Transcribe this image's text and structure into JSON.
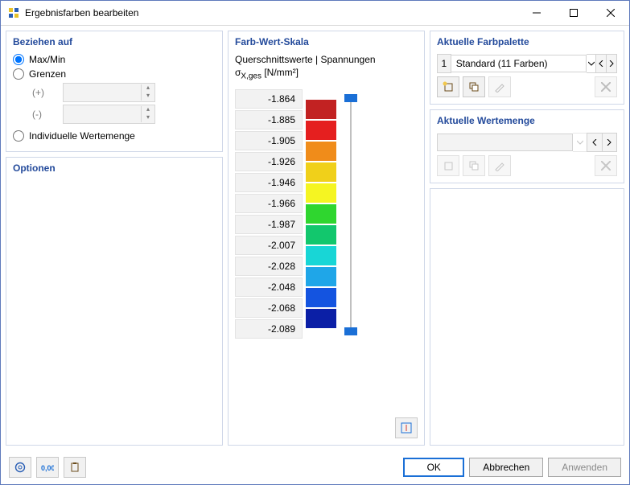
{
  "window": {
    "title": "Ergebnisfarben bearbeiten"
  },
  "left": {
    "refer_title": "Beziehen auf",
    "opt_maxmin": "Max/Min",
    "opt_bounds": "Grenzen",
    "plus": "(+)",
    "minus": "(-)",
    "opt_indiv": "Individuelle Wertemenge",
    "options_title": "Optionen"
  },
  "mid": {
    "title": "Farb-Wert-Skala",
    "sub1": "Querschnittswerte | Spannungen",
    "sub2": "σ",
    "sub2_idx": "X,ges",
    "sub2_unit": " [N/mm²]",
    "scale": [
      {
        "v": "-1.864",
        "c": "#c22222"
      },
      {
        "v": "-1.885",
        "c": "#e51f1f"
      },
      {
        "v": "-1.905",
        "c": "#f08c1a"
      },
      {
        "v": "-1.926",
        "c": "#f0d01a"
      },
      {
        "v": "-1.946",
        "c": "#f5f522"
      },
      {
        "v": "-1.966",
        "c": "#2fd62f"
      },
      {
        "v": "-1.987",
        "c": "#12c76d"
      },
      {
        "v": "-2.007",
        "c": "#18d6d6"
      },
      {
        "v": "-2.028",
        "c": "#1fa6e8"
      },
      {
        "v": "-2.048",
        "c": "#1454e0"
      },
      {
        "v": "-2.068",
        "c": "#0b1fa6"
      },
      {
        "v": "-2.089",
        "c": ""
      }
    ]
  },
  "right": {
    "palette_title": "Aktuelle Farbpalette",
    "palette_idx": "1",
    "palette_name": "Standard (11 Farben)",
    "valueset_title": "Aktuelle Wertemenge"
  },
  "footer": {
    "ok": "OK",
    "cancel": "Abbrechen",
    "apply": "Anwenden"
  }
}
